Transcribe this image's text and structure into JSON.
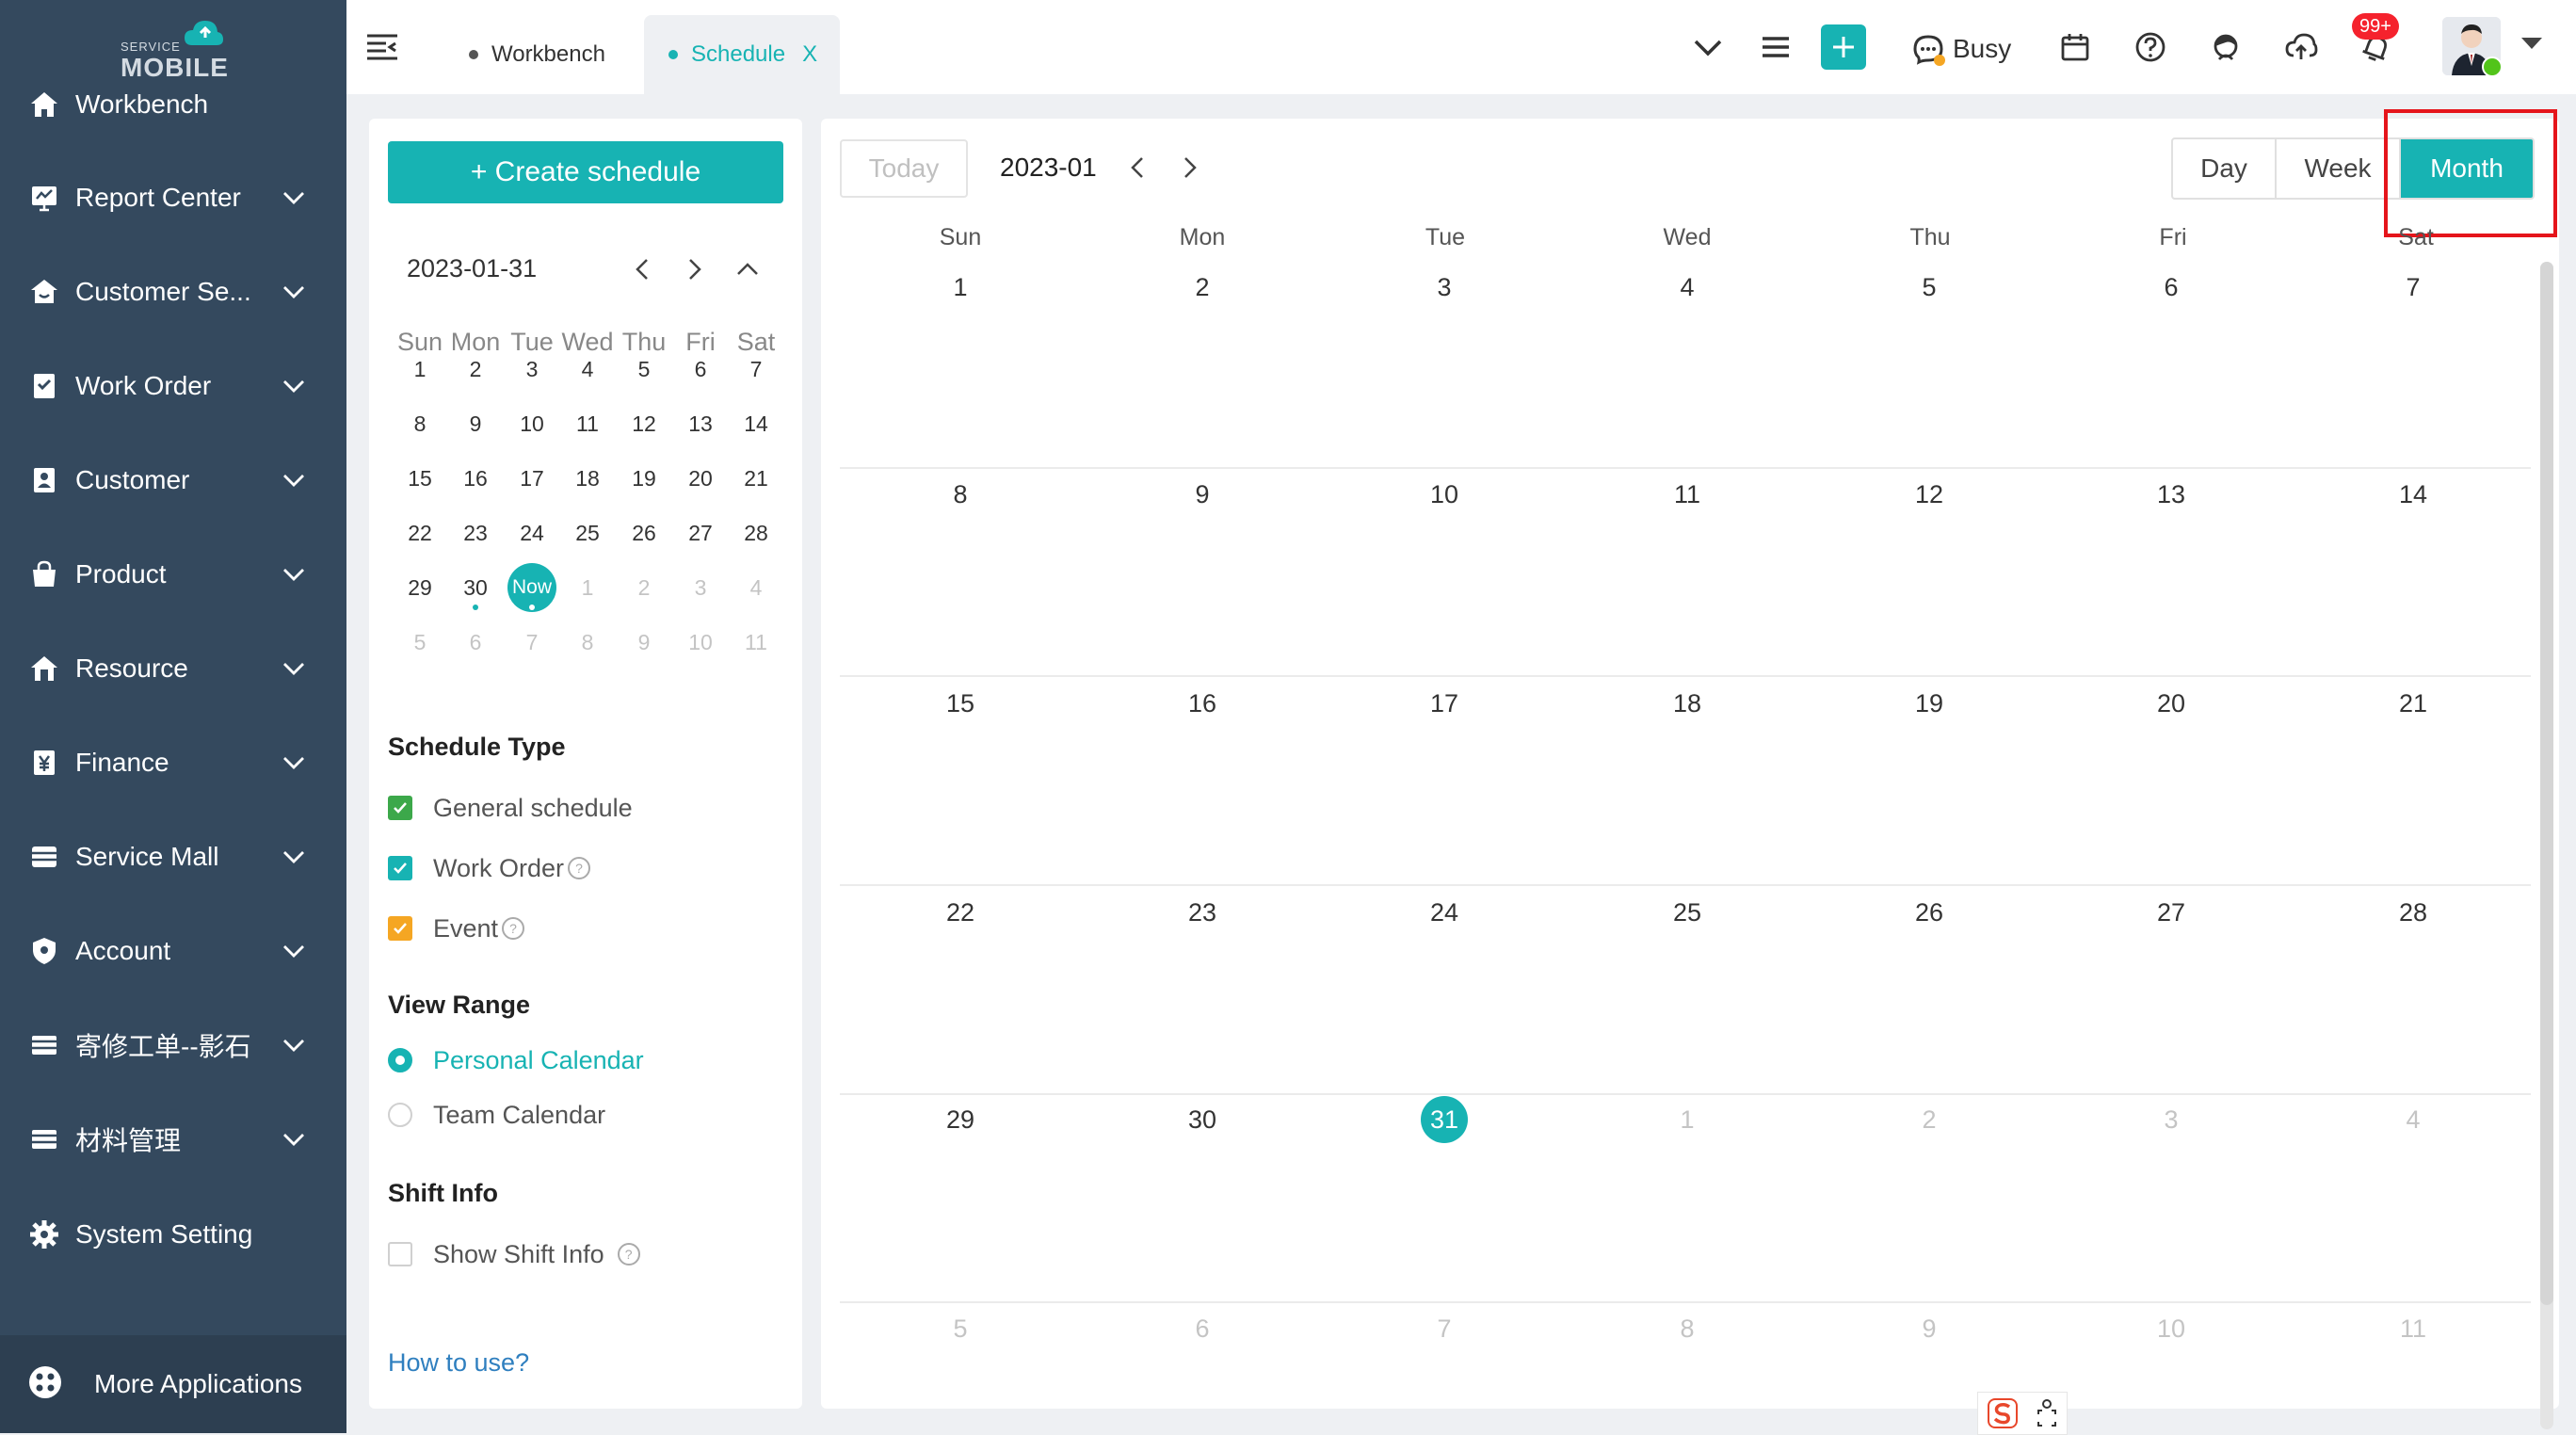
{
  "app": {
    "logo_small": "SERVICE",
    "logo_big": "MOBILE"
  },
  "sidebar": {
    "items": [
      {
        "label": "Workbench",
        "icon": "home-icon",
        "expandable": false
      },
      {
        "label": "Report Center",
        "icon": "report-icon",
        "expandable": true
      },
      {
        "label": "Customer Se...",
        "icon": "customer-service-icon",
        "expandable": true
      },
      {
        "label": "Work Order",
        "icon": "work-order-icon",
        "expandable": true
      },
      {
        "label": "Customer",
        "icon": "customer-icon",
        "expandable": true
      },
      {
        "label": "Product",
        "icon": "product-icon",
        "expandable": true
      },
      {
        "label": "Resource",
        "icon": "resource-icon",
        "expandable": true
      },
      {
        "label": "Finance",
        "icon": "finance-icon",
        "expandable": true
      },
      {
        "label": "Service Mall",
        "icon": "service-mall-icon",
        "expandable": true
      },
      {
        "label": "Account",
        "icon": "account-icon",
        "expandable": true
      },
      {
        "label": "寄修工单--影石",
        "icon": "repair-order-icon",
        "expandable": true
      },
      {
        "label": "材料管理",
        "icon": "material-icon",
        "expandable": true
      },
      {
        "label": "System Setting",
        "icon": "gear-icon",
        "expandable": false
      }
    ],
    "more_apps": "More Applications"
  },
  "topbar": {
    "tabs": [
      {
        "label": "Workbench",
        "active": false
      },
      {
        "label": "Schedule",
        "active": true,
        "close": "X"
      }
    ],
    "status": "Busy",
    "notification_badge": "99+"
  },
  "left_panel": {
    "create_button": "+ Create schedule",
    "mini_calendar": {
      "date": "2023-01-31",
      "weekdays": [
        "Sun",
        "Mon",
        "Tue",
        "Wed",
        "Thu",
        "Fri",
        "Sat"
      ],
      "weeks": [
        [
          "1",
          "2",
          "3",
          "4",
          "5",
          "6",
          "7"
        ],
        [
          "8",
          "9",
          "10",
          "11",
          "12",
          "13",
          "14"
        ],
        [
          "15",
          "16",
          "17",
          "18",
          "19",
          "20",
          "21"
        ],
        [
          "22",
          "23",
          "24",
          "25",
          "26",
          "27",
          "28"
        ],
        [
          "29",
          "30",
          "Now",
          "1",
          "2",
          "3",
          "4"
        ],
        [
          "5",
          "6",
          "7",
          "8",
          "9",
          "10",
          "11"
        ]
      ],
      "today_label": "Now"
    },
    "schedule_type": {
      "title": "Schedule Type",
      "items": [
        {
          "label": "General schedule",
          "color": "#3ca84a",
          "checked": true,
          "help": false
        },
        {
          "label": "Work Order",
          "color": "#17b3b3",
          "checked": true,
          "help": true
        },
        {
          "label": "Event",
          "color": "#f5a623",
          "checked": true,
          "help": true
        }
      ]
    },
    "view_range": {
      "title": "View Range",
      "options": [
        {
          "label": "Personal Calendar",
          "selected": true
        },
        {
          "label": "Team Calendar",
          "selected": false
        }
      ]
    },
    "shift_info": {
      "title": "Shift Info",
      "show_label": "Show Shift Info",
      "checked": false
    },
    "how_to": "How to use?"
  },
  "calendar": {
    "today_button": "Today",
    "month_label": "2023-01",
    "views": [
      "Day",
      "Week",
      "Month"
    ],
    "active_view": "Month",
    "weekdays": [
      "Sun",
      "Mon",
      "Tue",
      "Wed",
      "Thu",
      "Fri",
      "Sat"
    ],
    "weeks": [
      [
        "1",
        "2",
        "3",
        "4",
        "5",
        "6",
        "7"
      ],
      [
        "8",
        "9",
        "10",
        "11",
        "12",
        "13",
        "14"
      ],
      [
        "15",
        "16",
        "17",
        "18",
        "19",
        "20",
        "21"
      ],
      [
        "22",
        "23",
        "24",
        "25",
        "26",
        "27",
        "28"
      ],
      [
        "29",
        "30",
        "31",
        "1",
        "2",
        "3",
        "4"
      ],
      [
        "5",
        "6",
        "7",
        "8",
        "9",
        "10",
        "11"
      ]
    ],
    "today_date": "31"
  },
  "colors": {
    "accent": "#17b3b3",
    "sidebar_bg": "#34495e",
    "highlight": "#e5151b",
    "badge": "#f5222d",
    "online": "#52c41a"
  }
}
